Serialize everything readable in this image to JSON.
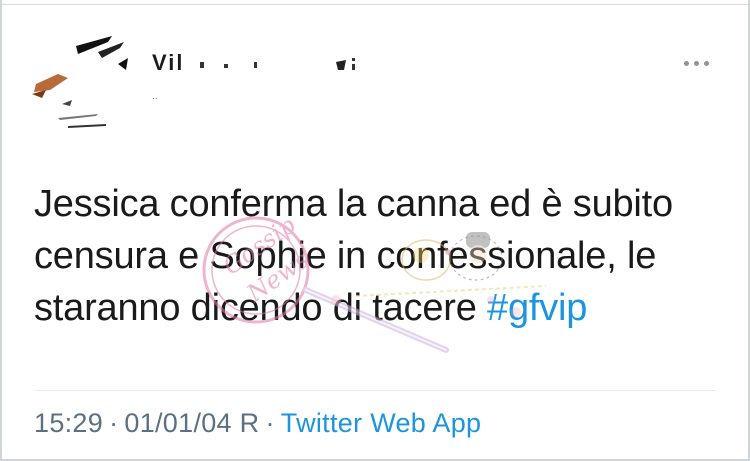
{
  "tweet": {
    "author": {
      "display_name": "Vil",
      "handle_fragment": ".."
    },
    "text_lines": [
      "Jessica conferma la canna ed è subito",
      "censura e Sophie in confessionale, le",
      "staranno dicendo di tacere "
    ],
    "hashtag": "#gfvip",
    "time": "15:29",
    "separator": "·",
    "date": "01/01/04 R",
    "source": "Twitter Web App"
  },
  "watermark": {
    "lines": [
      "Gossip",
      "News"
    ]
  },
  "colors": {
    "text": "#1a1a1a",
    "link": "#1b95e0",
    "meta": "#5b7083",
    "watermark": "#e07aa8"
  },
  "icons": {
    "more": "more-horizontal-icon",
    "avatar": "avatar-image"
  }
}
